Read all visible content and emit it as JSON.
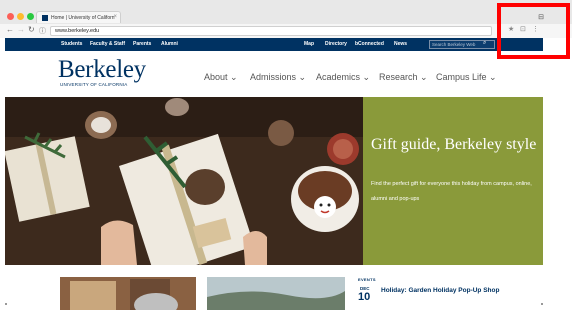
{
  "browser": {
    "tab_title": "Home | University of Californ",
    "tab_close": "×",
    "url": "www.berkeley.edu",
    "window_user_glyph": "⊟",
    "icons": [
      "back-arrow-icon",
      "forward-arrow-icon",
      "reload-icon",
      "info-icon",
      "star-icon",
      "extension-icon",
      "menu-icon"
    ],
    "traffic_light_colors": [
      "#fc5f57",
      "#fdbb2e",
      "#29c940"
    ]
  },
  "utility_nav": {
    "left": [
      "Students",
      "Faculty & Staff",
      "Parents",
      "Alumni"
    ],
    "right": [
      "Map",
      "Directory",
      "bConnected",
      "News"
    ],
    "search_placeholder": "Search Berkeley Web",
    "background": "#003262"
  },
  "logo": {
    "word": "Berkeley",
    "subtitle": "UNIVERSITY OF CALIFORNIA"
  },
  "main_nav": [
    "About",
    "Admissions",
    "Academics",
    "Research",
    "Campus Life"
  ],
  "hero": {
    "title": "Gift guide, Berkeley style",
    "description": "Find the perfect gift for everyone this holiday from campus, online, alumni and pop-ups",
    "panel_color": "#8a9a3a"
  },
  "events": {
    "label": "EVENTS",
    "month": "DEC",
    "day": "10",
    "title": "Holiday: Garden Holiday Pop-Up Shop"
  },
  "annotation": {
    "color": "#ff0000"
  }
}
